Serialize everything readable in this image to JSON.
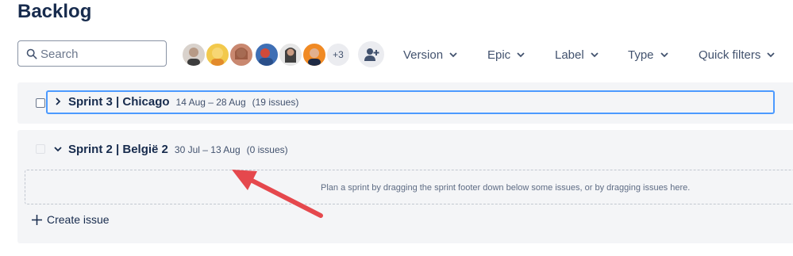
{
  "page": {
    "title": "Backlog"
  },
  "toolbar": {
    "search_placeholder": "Search",
    "avatars_more": "+3",
    "filters": [
      {
        "label": "Version"
      },
      {
        "label": "Epic"
      },
      {
        "label": "Label"
      },
      {
        "label": "Type"
      },
      {
        "label": "Quick filters"
      }
    ]
  },
  "sprints": [
    {
      "name": "Sprint 3 | Chicago",
      "dates": "14 Aug – 28 Aug",
      "count": "(19 issues)",
      "expanded": false
    },
    {
      "name": "Sprint 2 | België 2",
      "dates": "30 Jul – 13 Aug",
      "count": "(0 issues)",
      "expanded": true,
      "empty_message": "Plan a sprint by dragging the sprint footer down below some issues, or by dragging issues here.",
      "create_label": "Create issue"
    }
  ],
  "colors": {
    "accent": "#4c9aff",
    "arrow": "#e5484d"
  }
}
